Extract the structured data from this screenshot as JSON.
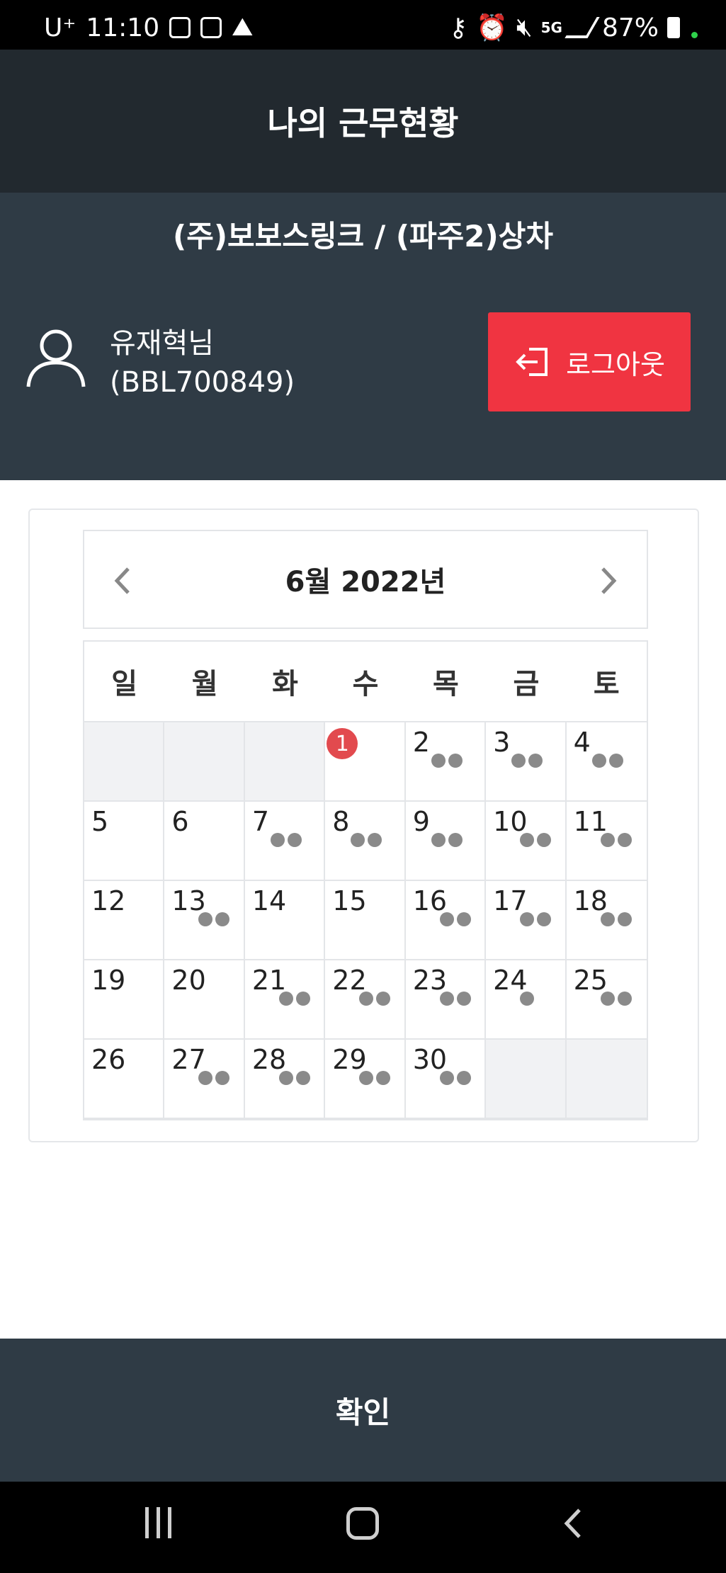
{
  "status_bar": {
    "carrier": "U⁺",
    "time": "11:10",
    "battery": "87%",
    "network": "5G"
  },
  "header": {
    "title": "나의 근무현황"
  },
  "info": {
    "company": "(주)보보스링크 / (파주2)상차",
    "user_name": "유재혁님",
    "user_id": "(BBL700849)",
    "logout_label": "로그아웃",
    "logout_color": "#f03441"
  },
  "calendar": {
    "month_title": "6월 2022년",
    "weekdays": [
      "일",
      "월",
      "화",
      "수",
      "목",
      "금",
      "토"
    ],
    "today_badge": "1",
    "days": [
      {
        "day": "",
        "dots": 0,
        "empty": true
      },
      {
        "day": "",
        "dots": 0,
        "empty": true
      },
      {
        "day": "",
        "dots": 0,
        "empty": true
      },
      {
        "day": "1",
        "dots": 0,
        "badge": true
      },
      {
        "day": "2",
        "dots": 2
      },
      {
        "day": "3",
        "dots": 2
      },
      {
        "day": "4",
        "dots": 2
      },
      {
        "day": "5",
        "dots": 0
      },
      {
        "day": "6",
        "dots": 0
      },
      {
        "day": "7",
        "dots": 2
      },
      {
        "day": "8",
        "dots": 2
      },
      {
        "day": "9",
        "dots": 2
      },
      {
        "day": "10",
        "dots": 2
      },
      {
        "day": "11",
        "dots": 2
      },
      {
        "day": "12",
        "dots": 0
      },
      {
        "day": "13",
        "dots": 2
      },
      {
        "day": "14",
        "dots": 0
      },
      {
        "day": "15",
        "dots": 0
      },
      {
        "day": "16",
        "dots": 2
      },
      {
        "day": "17",
        "dots": 2
      },
      {
        "day": "18",
        "dots": 2
      },
      {
        "day": "19",
        "dots": 0
      },
      {
        "day": "20",
        "dots": 0
      },
      {
        "day": "21",
        "dots": 2
      },
      {
        "day": "22",
        "dots": 2
      },
      {
        "day": "23",
        "dots": 2
      },
      {
        "day": "24",
        "dots": 1
      },
      {
        "day": "25",
        "dots": 2
      },
      {
        "day": "26",
        "dots": 0
      },
      {
        "day": "27",
        "dots": 2
      },
      {
        "day": "28",
        "dots": 2
      },
      {
        "day": "29",
        "dots": 2
      },
      {
        "day": "30",
        "dots": 2
      },
      {
        "day": "",
        "dots": 0,
        "empty": true
      },
      {
        "day": "",
        "dots": 0,
        "empty": true
      }
    ]
  },
  "footer": {
    "confirm_label": "확인"
  },
  "icons": {
    "status_icons": [
      "gallery-icon",
      "record-icon",
      "navigation-icon",
      "key-icon",
      "alarm-icon",
      "mute-icon",
      "signal-icon",
      "battery-icon"
    ],
    "nav": [
      "recent-apps-icon",
      "home-icon",
      "back-icon"
    ]
  }
}
